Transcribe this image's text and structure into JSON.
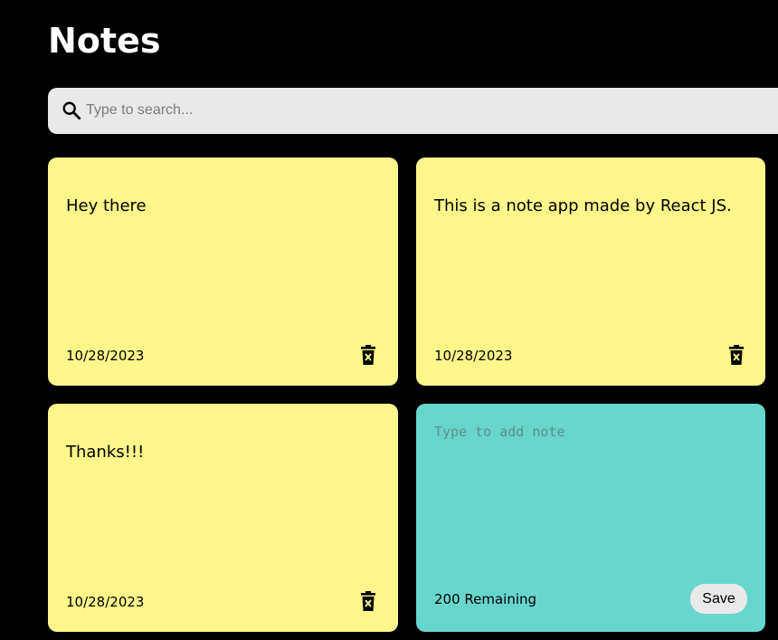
{
  "header": {
    "title": "Notes"
  },
  "search": {
    "placeholder": "Type to search..."
  },
  "notes": [
    {
      "text": "Hey there",
      "date": "10/28/2023"
    },
    {
      "text": "This is a note app made by React JS.",
      "date": "10/28/2023"
    },
    {
      "text": "Thanks!!!",
      "date": "10/28/2023"
    }
  ],
  "new_note": {
    "placeholder": "Type to add note",
    "remaining": "200 Remaining",
    "save_label": "Save"
  },
  "colors": {
    "background": "#000000",
    "note_yellow": "#fef68a",
    "new_note_teal": "#67d7cc",
    "search_bg": "#e9e9e9"
  },
  "icons": [
    "search-icon",
    "delete-icon"
  ]
}
